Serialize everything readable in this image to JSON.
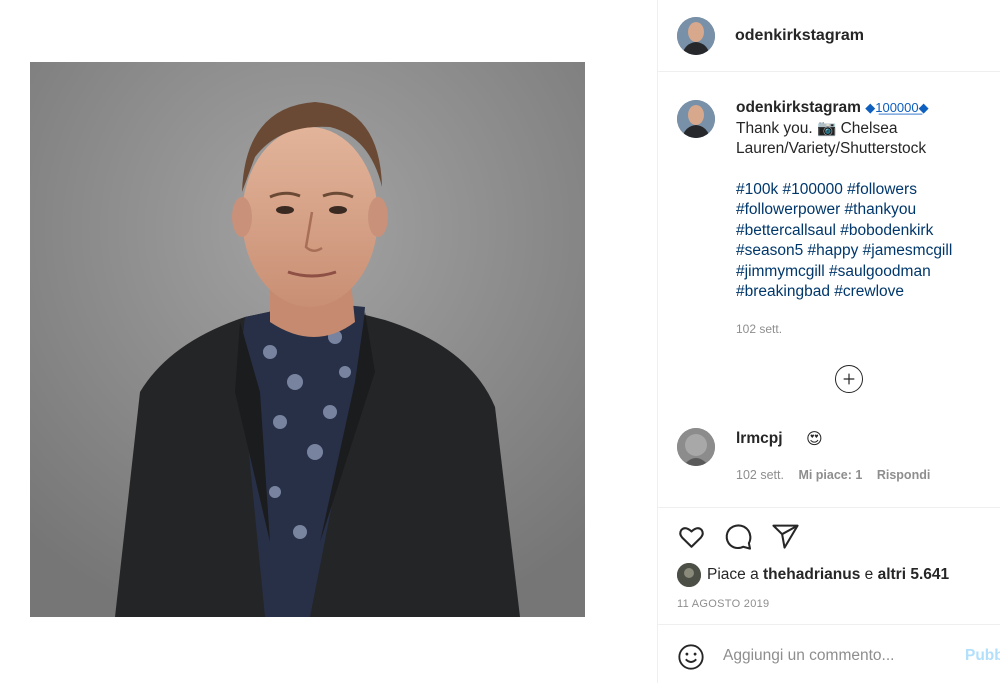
{
  "post": {
    "photo_alt": "portrait",
    "author": "odenkirkstagram"
  },
  "header": {
    "username": "odenkirkstagram"
  },
  "caption": {
    "username": "odenkirkstagram",
    "badge": "◆1̲0̲0̲0̲0̲0̲◆",
    "text_line1": "Thank you. 📷 Chelsea",
    "text_line2": "Lauren/Variety/Shutterstock",
    "hashtags": [
      "#100k #100000 #followers",
      "#followerpower #thankyou",
      "#bettercallsaul #bobodenkirk",
      "#season5 #happy #jamesmcgill",
      "#jimmymcgill #saulgoodman",
      "#breakingbad #crewlove"
    ],
    "time": "102 sett."
  },
  "load_more": "⊕",
  "comment": {
    "username": "lrmcpj",
    "emoji": "😍",
    "time": "102 sett.",
    "likes": "Mi piace: 1",
    "reply": "Rispondi"
  },
  "likes": {
    "prefix": "Piace a",
    "user": "thehadrianus",
    "conj": "e",
    "others": "altri 5.641"
  },
  "date": "11 AGOSTO 2019",
  "add_comment": {
    "placeholder": "Aggiungi un commento...",
    "publish": "Pubb"
  },
  "icons": [
    "heart-icon",
    "comment-icon",
    "share-icon",
    "plus-circle-icon",
    "smile-icon"
  ]
}
